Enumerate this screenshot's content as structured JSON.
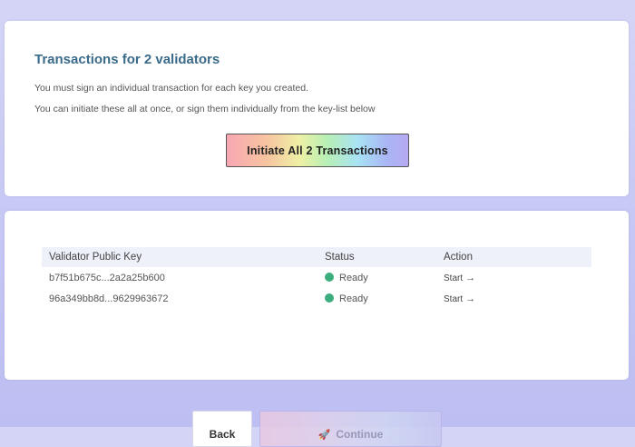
{
  "summary": {
    "title": "Transactions for 2 validators",
    "line1": "You must sign an individual transaction for each key you created.",
    "line2": "You can initiate these all at once, or sign them individually from the key-list below",
    "initiate_label": "Initiate All 2 Transactions"
  },
  "table": {
    "headers": {
      "key": "Validator Public Key",
      "status": "Status",
      "action": "Action"
    },
    "rows": [
      {
        "key": "b7f51b675c...2a2a25b600",
        "status": "Ready",
        "action": "Start"
      },
      {
        "key": "96a349bb8d...9629963672",
        "status": "Ready",
        "action": "Start"
      }
    ]
  },
  "nav": {
    "back_label": "Back",
    "continue_label": "Continue"
  },
  "colors": {
    "title": "#3b6b8a",
    "status_ready": "#3cae7d",
    "background": "#c6c7f4"
  },
  "icons": {
    "status": "green-circle-icon",
    "action": "arrow-right-icon",
    "continue": "rocket-icon"
  }
}
